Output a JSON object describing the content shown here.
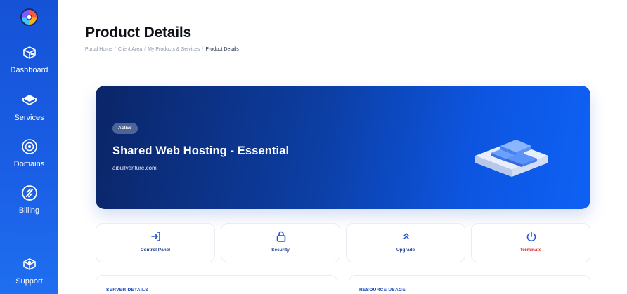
{
  "sidebar": {
    "items": [
      {
        "label": "Dashboard",
        "icon": "dashboard-icon"
      },
      {
        "label": "Services",
        "icon": "services-icon"
      },
      {
        "label": "Domains",
        "icon": "domains-icon"
      },
      {
        "label": "Billing",
        "icon": "billing-icon"
      },
      {
        "label": "Support",
        "icon": "support-icon"
      }
    ]
  },
  "header": {
    "title": "Product Details",
    "breadcrumb": [
      "Portal Home",
      "Client Area",
      "My Products & Services",
      "Product Details"
    ],
    "breadcrumb_separator": "/"
  },
  "hero": {
    "status": "Active",
    "product_name": "Shared Web Hosting - Essential",
    "domain": "aibullventure.com"
  },
  "actions": [
    {
      "label": "Control Panel",
      "icon": "login-icon"
    },
    {
      "label": "Security",
      "icon": "lock-icon"
    },
    {
      "label": "Upgrade",
      "icon": "chevrons-up-icon"
    },
    {
      "label": "Terminate",
      "icon": "power-icon"
    }
  ],
  "panels": {
    "server_details": "SERVER DETAILS",
    "resource_usage": "RESOURCE USAGE"
  },
  "colors": {
    "sidebar": "#1a5fe6",
    "accent": "#0d55e0",
    "danger": "#e02424"
  }
}
